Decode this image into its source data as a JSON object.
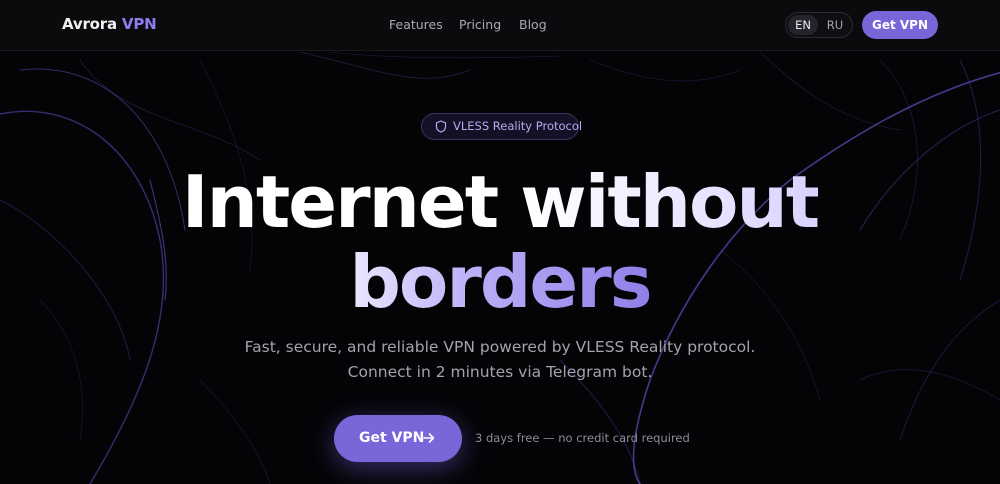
{
  "header": {
    "logo_main": "Avrora",
    "logo_accent": "VPN",
    "nav": [
      {
        "label": "Features"
      },
      {
        "label": "Pricing"
      },
      {
        "label": "Blog"
      }
    ],
    "languages": [
      {
        "label": "EN",
        "active": true
      },
      {
        "label": "RU",
        "active": false
      }
    ],
    "cta_label": "Get VPN"
  },
  "hero": {
    "badge_icon": "shield-icon",
    "badge_label": "VLESS Reality Protocol",
    "title_line1": "Internet without",
    "title_line2": "borders",
    "subtitle_line1": "Fast, secure, and reliable VPN powered by VLESS Reality protocol.",
    "subtitle_line2": "Connect in 2 minutes via Telegram bot.",
    "cta_label": "Get VPN",
    "cta_icon": "arrow-right-icon",
    "cta_note": "3 days free — no credit card required"
  },
  "colors": {
    "accent": "#7a65d8",
    "background": "#040406",
    "header_bg": "#0b0b0e"
  }
}
